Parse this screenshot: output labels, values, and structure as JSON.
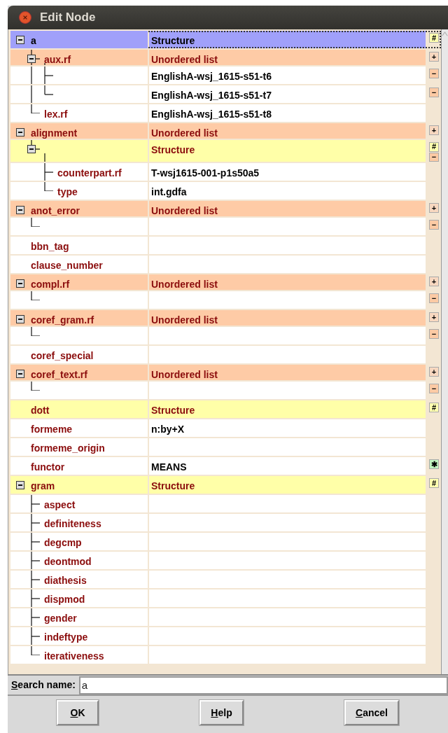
{
  "window": {
    "title": "Edit Node"
  },
  "tree": [
    {
      "name": "a",
      "value": "Structure",
      "kind": "structure",
      "selected": true,
      "expanded": true,
      "actions": [
        {
          "kind": "structure",
          "symbol": "#"
        }
      ],
      "children": [
        {
          "name": "aux.rf",
          "value": "Unordered list",
          "kind": "list",
          "selected": false,
          "expanded": true,
          "actions": [
            {
              "kind": "add",
              "symbol": "+"
            }
          ],
          "children": [
            {
              "value": "EnglishA-wsj_1615-s51-t6",
              "kind": "plain",
              "selected": false,
              "actions": [
                {
                  "kind": "remove",
                  "symbol": "−"
                }
              ]
            },
            {
              "value": "EnglishA-wsj_1615-s51-t7",
              "kind": "plain",
              "selected": false,
              "actions": [
                {
                  "kind": "remove",
                  "symbol": "−"
                }
              ]
            }
          ]
        },
        {
          "name": "lex.rf",
          "value": "EnglishA-wsj_1615-s51-t8",
          "kind": "plain",
          "selected": false
        }
      ]
    },
    {
      "name": "alignment",
      "value": "Unordered list",
      "kind": "list",
      "selected": false,
      "expanded": true,
      "actions": [
        {
          "kind": "add",
          "symbol": "+"
        }
      ],
      "children": [
        {
          "value": "Structure",
          "kind": "structure",
          "selected": false,
          "expanded": true,
          "actions": [
            {
              "kind": "structure",
              "symbol": "#"
            },
            {
              "kind": "remove",
              "symbol": "−"
            }
          ],
          "children": [
            {
              "name": "counterpart.rf",
              "value": "T-wsj1615-001-p1s50a5",
              "kind": "plain",
              "selected": false
            },
            {
              "name": "type",
              "value": "int.gdfa",
              "kind": "plain",
              "selected": false
            }
          ]
        }
      ]
    },
    {
      "name": "anot_error",
      "value": "Unordered list",
      "kind": "list",
      "selected": false,
      "expanded": true,
      "actions": [
        {
          "kind": "add",
          "symbol": "+"
        }
      ],
      "children": [
        {
          "kind": "plain",
          "selected": false,
          "actions": [
            {
              "kind": "remove",
              "symbol": "−"
            }
          ]
        }
      ]
    },
    {
      "name": "bbn_tag",
      "kind": "plain",
      "selected": false
    },
    {
      "name": "clause_number",
      "kind": "plain",
      "selected": false
    },
    {
      "name": "compl.rf",
      "value": "Unordered list",
      "kind": "list",
      "selected": false,
      "expanded": true,
      "actions": [
        {
          "kind": "add",
          "symbol": "+"
        }
      ],
      "children": [
        {
          "kind": "plain",
          "selected": false,
          "actions": [
            {
              "kind": "remove",
              "symbol": "−"
            }
          ]
        }
      ]
    },
    {
      "name": "coref_gram.rf",
      "value": "Unordered list",
      "kind": "list",
      "selected": false,
      "expanded": true,
      "actions": [
        {
          "kind": "add",
          "symbol": "+"
        }
      ],
      "children": [
        {
          "kind": "plain",
          "selected": false,
          "actions": [
            {
              "kind": "remove",
              "symbol": "−"
            }
          ]
        }
      ]
    },
    {
      "name": "coref_special",
      "kind": "plain",
      "selected": false
    },
    {
      "name": "coref_text.rf",
      "value": "Unordered list",
      "kind": "list",
      "selected": false,
      "expanded": true,
      "actions": [
        {
          "kind": "add",
          "symbol": "+"
        }
      ],
      "children": [
        {
          "kind": "plain",
          "selected": false,
          "actions": [
            {
              "kind": "remove",
              "symbol": "−"
            }
          ]
        }
      ]
    },
    {
      "name": "dott",
      "value": "Structure",
      "kind": "structure",
      "selected": false,
      "actions": [
        {
          "kind": "structure",
          "symbol": "#"
        }
      ]
    },
    {
      "name": "formeme",
      "value": "n:by+X",
      "kind": "plain",
      "selected": false
    },
    {
      "name": "formeme_origin",
      "kind": "plain",
      "selected": false
    },
    {
      "name": "functor",
      "value": "MEANS",
      "kind": "plain",
      "selected": false,
      "actions": [
        {
          "kind": "choice",
          "symbol": "✱"
        }
      ]
    },
    {
      "name": "gram",
      "value": "Structure",
      "kind": "structure",
      "selected": false,
      "expanded": true,
      "actions": [
        {
          "kind": "structure",
          "symbol": "#"
        }
      ],
      "children": [
        {
          "name": "aspect",
          "kind": "plain",
          "selected": false
        },
        {
          "name": "definiteness",
          "kind": "plain",
          "selected": false
        },
        {
          "name": "degcmp",
          "kind": "plain",
          "selected": false
        },
        {
          "name": "deontmod",
          "kind": "plain",
          "selected": false
        },
        {
          "name": "diathesis",
          "kind": "plain",
          "selected": false
        },
        {
          "name": "dispmod",
          "kind": "plain",
          "selected": false
        },
        {
          "name": "gender",
          "kind": "plain",
          "selected": false
        },
        {
          "name": "indeftype",
          "kind": "plain",
          "selected": false
        },
        {
          "name": "iterativeness",
          "kind": "plain",
          "selected": false
        }
      ]
    }
  ],
  "search": {
    "label": "Search name:",
    "value": "a"
  },
  "buttons": [
    {
      "label": "OK"
    },
    {
      "label": "Help"
    },
    {
      "label": "Cancel"
    }
  ]
}
